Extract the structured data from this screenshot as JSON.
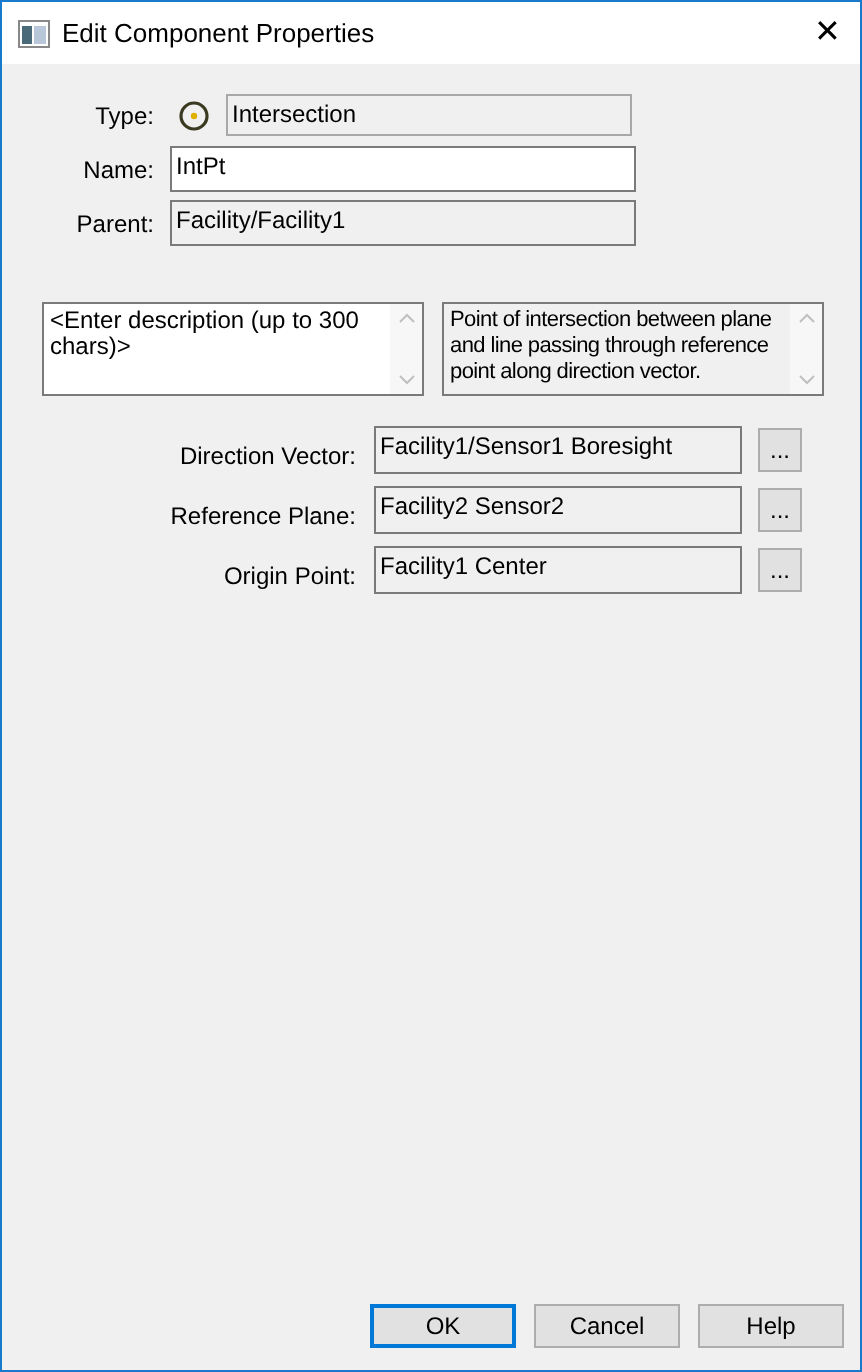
{
  "window": {
    "title": "Edit Component Properties",
    "close": "✕"
  },
  "header_fields": [
    {
      "label": "Type:",
      "value": "Intersection",
      "readonly": true,
      "kind": "type"
    },
    {
      "label": "Name:",
      "value": "IntPt",
      "readonly": false,
      "kind": "plain"
    },
    {
      "label": "Parent:",
      "value": "Facility/Facility1",
      "readonly": true,
      "kind": "plain"
    }
  ],
  "description": {
    "placeholder": "<Enter description (up to 300 chars)>"
  },
  "info": {
    "text": "Point of intersection between plane and line passing through reference point along direction vector."
  },
  "links": [
    {
      "label": "Direction Vector:",
      "value": "Facility1/Sensor1 Boresight",
      "button": "..."
    },
    {
      "label": "Reference Plane:",
      "value": "Facility2 Sensor2",
      "button": "..."
    },
    {
      "label": "Origin Point:",
      "value": "Facility1 Center",
      "button": "..."
    }
  ],
  "buttons": [
    {
      "label": "OK",
      "default": true
    },
    {
      "label": "Cancel",
      "default": false
    },
    {
      "label": "Help",
      "default": false
    }
  ]
}
